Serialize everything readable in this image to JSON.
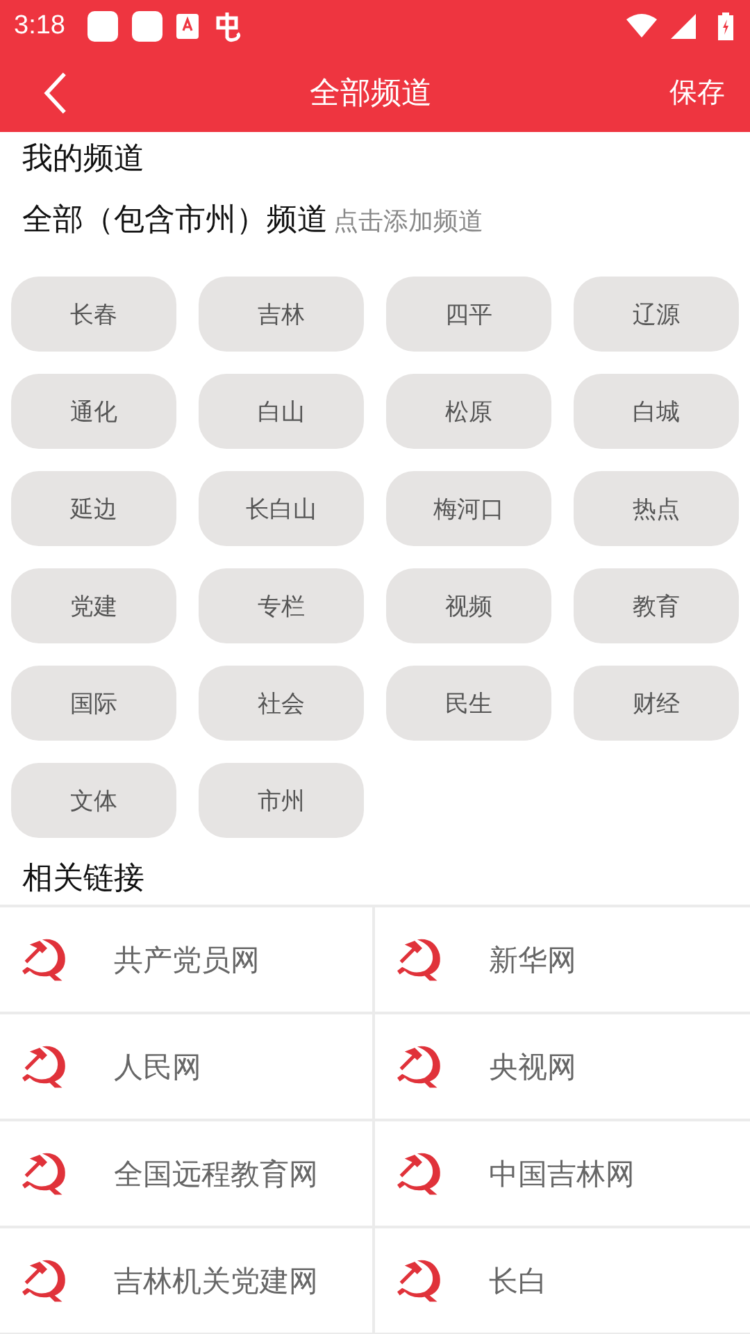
{
  "status_bar": {
    "time": "3:18"
  },
  "header": {
    "title": "全部频道",
    "action": "保存"
  },
  "my_channels": {
    "heading": "我的频道"
  },
  "all_channels": {
    "heading": "全部（包含市州）频道",
    "hint": "点击添加频道",
    "items": [
      "长春",
      "吉林",
      "四平",
      "辽源",
      "通化",
      "白山",
      "松原",
      "白城",
      "延边",
      "长白山",
      "梅河口",
      "热点",
      "党建",
      "专栏",
      "视频",
      "教育",
      "国际",
      "社会",
      "民生",
      "财经",
      "文体",
      "市州"
    ]
  },
  "related_links": {
    "heading": "相关链接",
    "items": [
      "共产党员网",
      "新华网",
      "人民网",
      "央视网",
      "全国远程教育网",
      "中国吉林网",
      "吉林机关党建网",
      "长白"
    ]
  }
}
